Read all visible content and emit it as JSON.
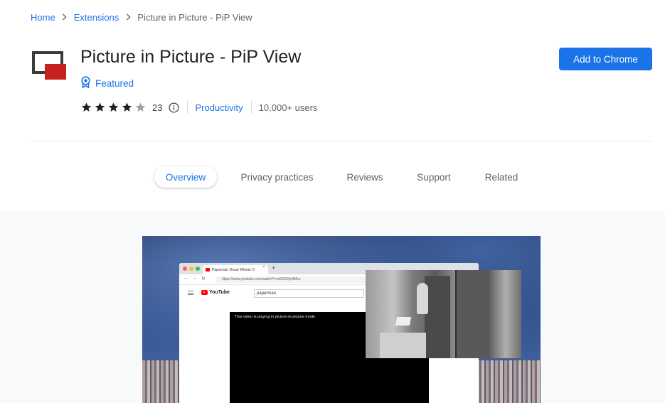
{
  "breadcrumb": {
    "home": "Home",
    "extensions": "Extensions",
    "current": "Picture in Picture - PiP View"
  },
  "extension": {
    "title": "Picture in Picture - PiP View",
    "featured_label": "Featured",
    "rating": 4,
    "rating_max": 5,
    "rating_count": "23",
    "category": "Productivity",
    "users": "10,000+ users"
  },
  "actions": {
    "add_to_chrome": "Add to Chrome"
  },
  "tabs": [
    {
      "label": "Overview",
      "active": true
    },
    {
      "label": "Privacy practices",
      "active": false
    },
    {
      "label": "Reviews",
      "active": false
    },
    {
      "label": "Support",
      "active": false
    },
    {
      "label": "Related",
      "active": false
    }
  ],
  "screenshot": {
    "tab_title": "Paperman Oscar Winner D",
    "url": "https://www.youtube.com/watch?v=eIlD3OlyNMoc",
    "youtube_logo": "YouTube",
    "search_query": "paperman",
    "video_message": "This video is playing in picture-in-picture mode"
  },
  "colors": {
    "accent": "#1a73e8",
    "logo_red": "#c5221f",
    "logo_dark": "#3c3c3c"
  }
}
